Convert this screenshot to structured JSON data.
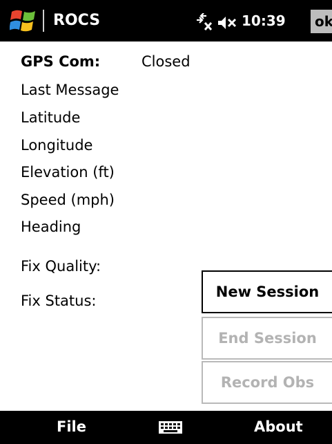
{
  "header": {
    "app_title": "ROCS",
    "time": "10:39",
    "ok_label": "ok",
    "icons": [
      "windows-start-icon",
      "connectivity-icon",
      "volume-muted-icon"
    ]
  },
  "gps": {
    "com_label": "GPS Com:",
    "com_value": "Closed",
    "last_message_label": "Last Message",
    "latitude_label": "Latitude",
    "longitude_label": "Longitude",
    "elevation_label": "Elevation (ft)",
    "speed_label": "Speed (mph)",
    "heading_label": "Heading",
    "fix_quality_label": "Fix Quality:",
    "fix_status_label": "Fix Status:"
  },
  "buttons": {
    "new_session": "New Session",
    "end_session": "End Session",
    "record_obs": "Record Obs"
  },
  "softkeys": {
    "left": "File",
    "right": "About",
    "center_icon": "keyboard-icon"
  },
  "colors": {
    "bar_background": "#000000",
    "disabled_text": "#b3b3b3",
    "ok_background": "#bdbdbd"
  }
}
